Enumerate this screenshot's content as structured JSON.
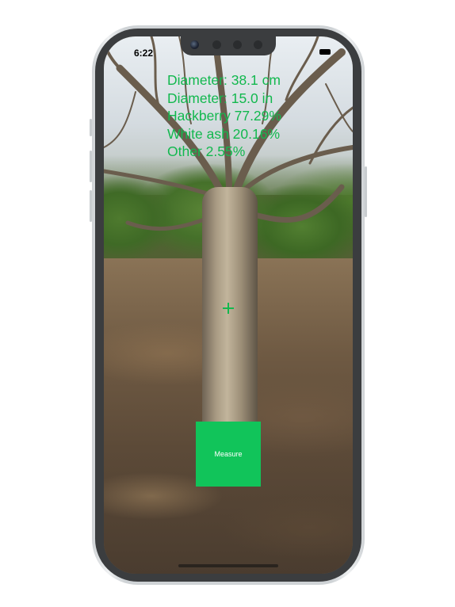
{
  "status_bar": {
    "time": "6:22"
  },
  "readout": {
    "lines": [
      "Diameter: 38.1 cm",
      "Diameter: 15.0 in",
      "Hackberry 77.29%",
      "White ash 20.16%",
      "Other 2.55%"
    ],
    "color": "#12b84e"
  },
  "measure_button": {
    "label": "Measure",
    "color": "#11c45a"
  },
  "icons": {
    "crosshair": "crosshair-icon",
    "battery": "battery-icon"
  }
}
